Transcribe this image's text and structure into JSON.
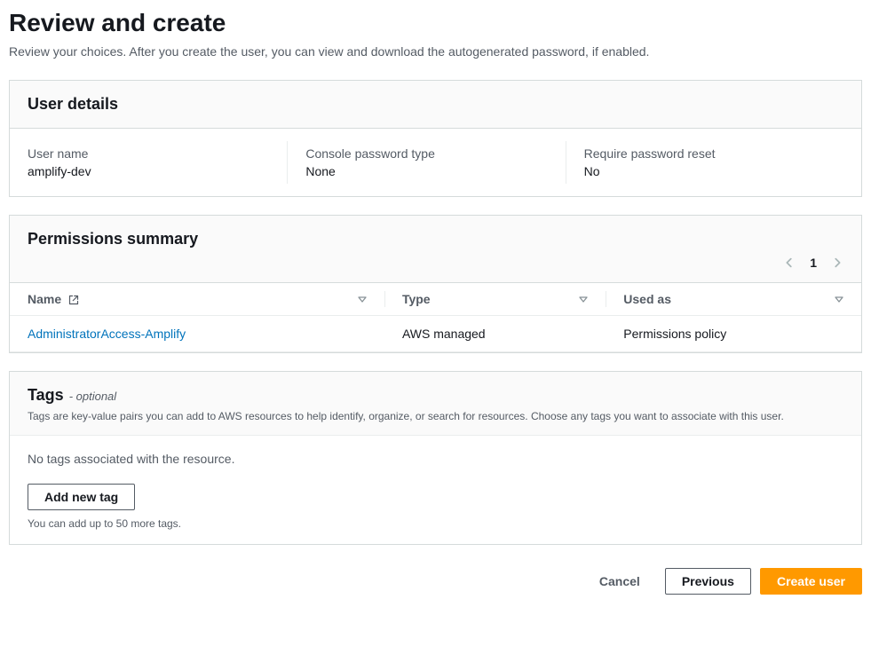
{
  "page": {
    "title": "Review and create",
    "description": "Review your choices. After you create the user, you can view and download the autogenerated password, if enabled."
  },
  "user_details": {
    "heading": "User details",
    "username_label": "User name",
    "username_value": "amplify-dev",
    "password_type_label": "Console password type",
    "password_type_value": "None",
    "reset_label": "Require password reset",
    "reset_value": "No"
  },
  "permissions": {
    "heading": "Permissions summary",
    "page_number": "1",
    "columns": {
      "name": "Name",
      "type": "Type",
      "used_as": "Used as"
    },
    "rows": [
      {
        "name": "AdministratorAccess-Amplify",
        "type": "AWS managed",
        "used_as": "Permissions policy"
      }
    ]
  },
  "tags": {
    "heading": "Tags",
    "optional_suffix": "- optional",
    "description": "Tags are key-value pairs you can add to AWS resources to help identify, organize, or search for resources. Choose any tags you want to associate with this user.",
    "empty_text": "No tags associated with the resource.",
    "add_button": "Add new tag",
    "limit_hint": "You can add up to 50 more tags."
  },
  "footer": {
    "cancel": "Cancel",
    "previous": "Previous",
    "create": "Create user"
  }
}
